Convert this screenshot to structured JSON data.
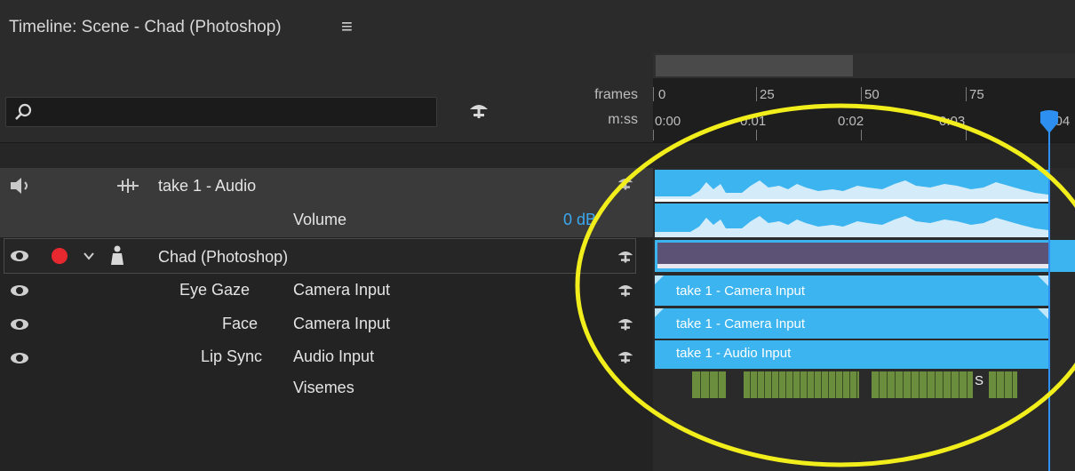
{
  "panel": {
    "title": "Timeline: Scene - Chad (Photoshop)",
    "menu_icon": "≡"
  },
  "search": {
    "placeholder": ""
  },
  "ruler": {
    "frames_label": "frames",
    "mss_label": "m:ss",
    "frame_ticks": [
      "0",
      "25",
      "50",
      "75"
    ],
    "time_ticks": [
      "0:00",
      "0:01",
      "0:02",
      "0:03",
      "0:04"
    ]
  },
  "tracks": {
    "audio": {
      "name": "take 1 - Audio",
      "volume_label": "Volume",
      "volume_value": "0 dB"
    },
    "puppet": {
      "name": "Chad (Photoshop)"
    },
    "eye_gaze": {
      "behavior": "Eye Gaze",
      "input": "Camera Input",
      "clip": "take 1 - Camera Input"
    },
    "face": {
      "behavior": "Face",
      "input": "Camera Input",
      "clip": "take 1 - Camera Input"
    },
    "lip_sync": {
      "behavior": "Lip Sync",
      "input": "Audio Input",
      "clip": "take 1 - Audio Input",
      "visemes_label": "Visemes",
      "viseme_letter": "S"
    }
  },
  "colors": {
    "accent": "#3bb4f0",
    "record": "#e8282f",
    "playhead": "#2d8ff0",
    "viseme": "#6b8e3e",
    "annotation": "#f2ee1c",
    "puppet_bar": "#5c5275"
  },
  "icons": {
    "search": "search-icon",
    "speaker": "speaker-icon",
    "eye": "eye-icon",
    "record": "record-dot-icon",
    "chevron": "chevron-down-icon",
    "puppet": "puppet-icon",
    "audio_track": "audio-track-icon",
    "arm": "arm-icon"
  }
}
